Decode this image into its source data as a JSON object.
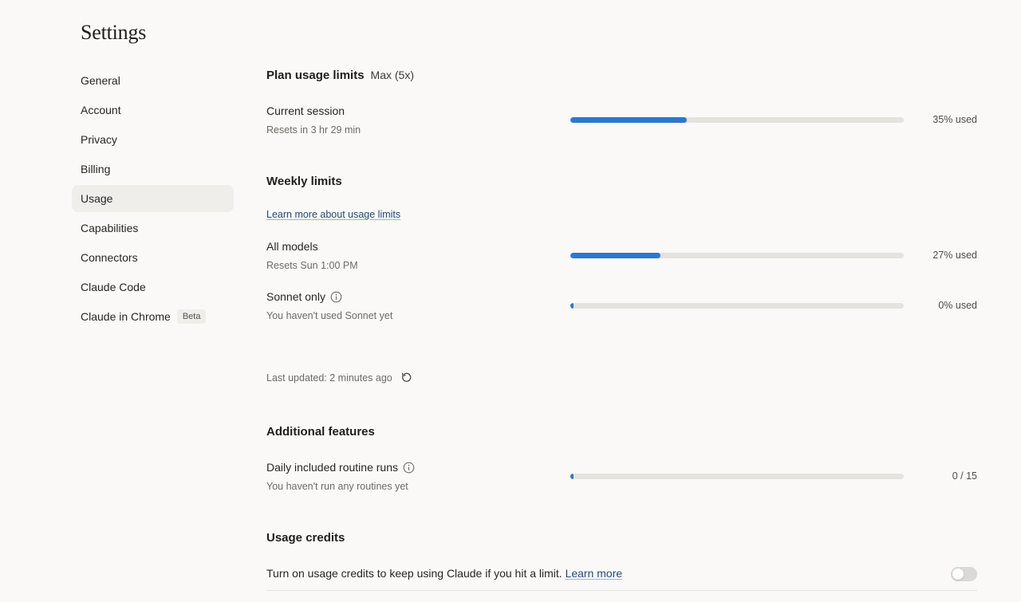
{
  "page": {
    "title": "Settings"
  },
  "sidebar": {
    "items": [
      {
        "label": "General"
      },
      {
        "label": "Account"
      },
      {
        "label": "Privacy"
      },
      {
        "label": "Billing"
      },
      {
        "label": "Usage",
        "active": true
      },
      {
        "label": "Capabilities"
      },
      {
        "label": "Connectors"
      },
      {
        "label": "Claude Code"
      },
      {
        "label": "Claude in Chrome",
        "badge": "Beta"
      }
    ]
  },
  "plan": {
    "heading": "Plan usage limits",
    "plan_name": "Max (5x)"
  },
  "session": {
    "label": "Current session",
    "sub": "Resets in 3 hr 29 min",
    "value_text": "35% used",
    "fraction": 0.35
  },
  "weekly": {
    "heading": "Weekly limits",
    "learn_more": "Learn more about usage limits",
    "all_models": {
      "label": "All models",
      "sub": "Resets Sun 1:00 PM",
      "value_text": "27% used",
      "fraction": 0.27
    },
    "sonnet": {
      "label": "Sonnet only",
      "sub": "You haven't used Sonnet yet",
      "value_text": "0% used",
      "fraction": 0.0
    }
  },
  "last_updated": {
    "text": "Last updated: 2 minutes ago",
    "refresh_icon": "refresh-icon"
  },
  "additional": {
    "heading": "Additional features",
    "routines": {
      "label": "Daily included routine runs",
      "sub": "You haven't run any routines yet",
      "value_text": "0 / 15",
      "fraction": 0.0
    }
  },
  "credits": {
    "heading": "Usage credits",
    "text": "Turn on usage credits to keep using Claude if you hit a limit.",
    "learn_more": "Learn more",
    "enabled": false
  },
  "colors": {
    "accent": "#2a78d1",
    "track": "#e4e3df",
    "background": "#faf9f7",
    "active_nav": "#efeeeb"
  }
}
